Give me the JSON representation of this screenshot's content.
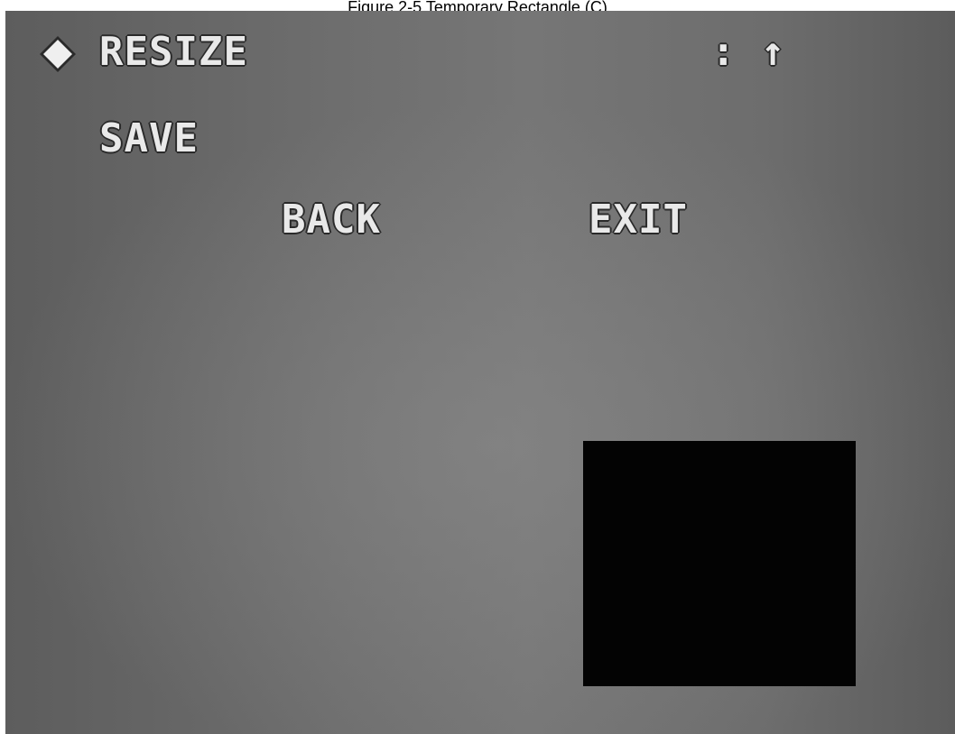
{
  "caption": "Figure 2-5 Temporary Rectangle (C)",
  "menu": {
    "cursor_icon": "diamond-icon",
    "resize_label": "RESIZE",
    "resize_value": ": ↑",
    "save_label": "SAVE",
    "back_label": "BACK",
    "exit_label": "EXIT"
  },
  "colors": {
    "osd_text": "#e9e9e9",
    "mask": "#030303"
  }
}
